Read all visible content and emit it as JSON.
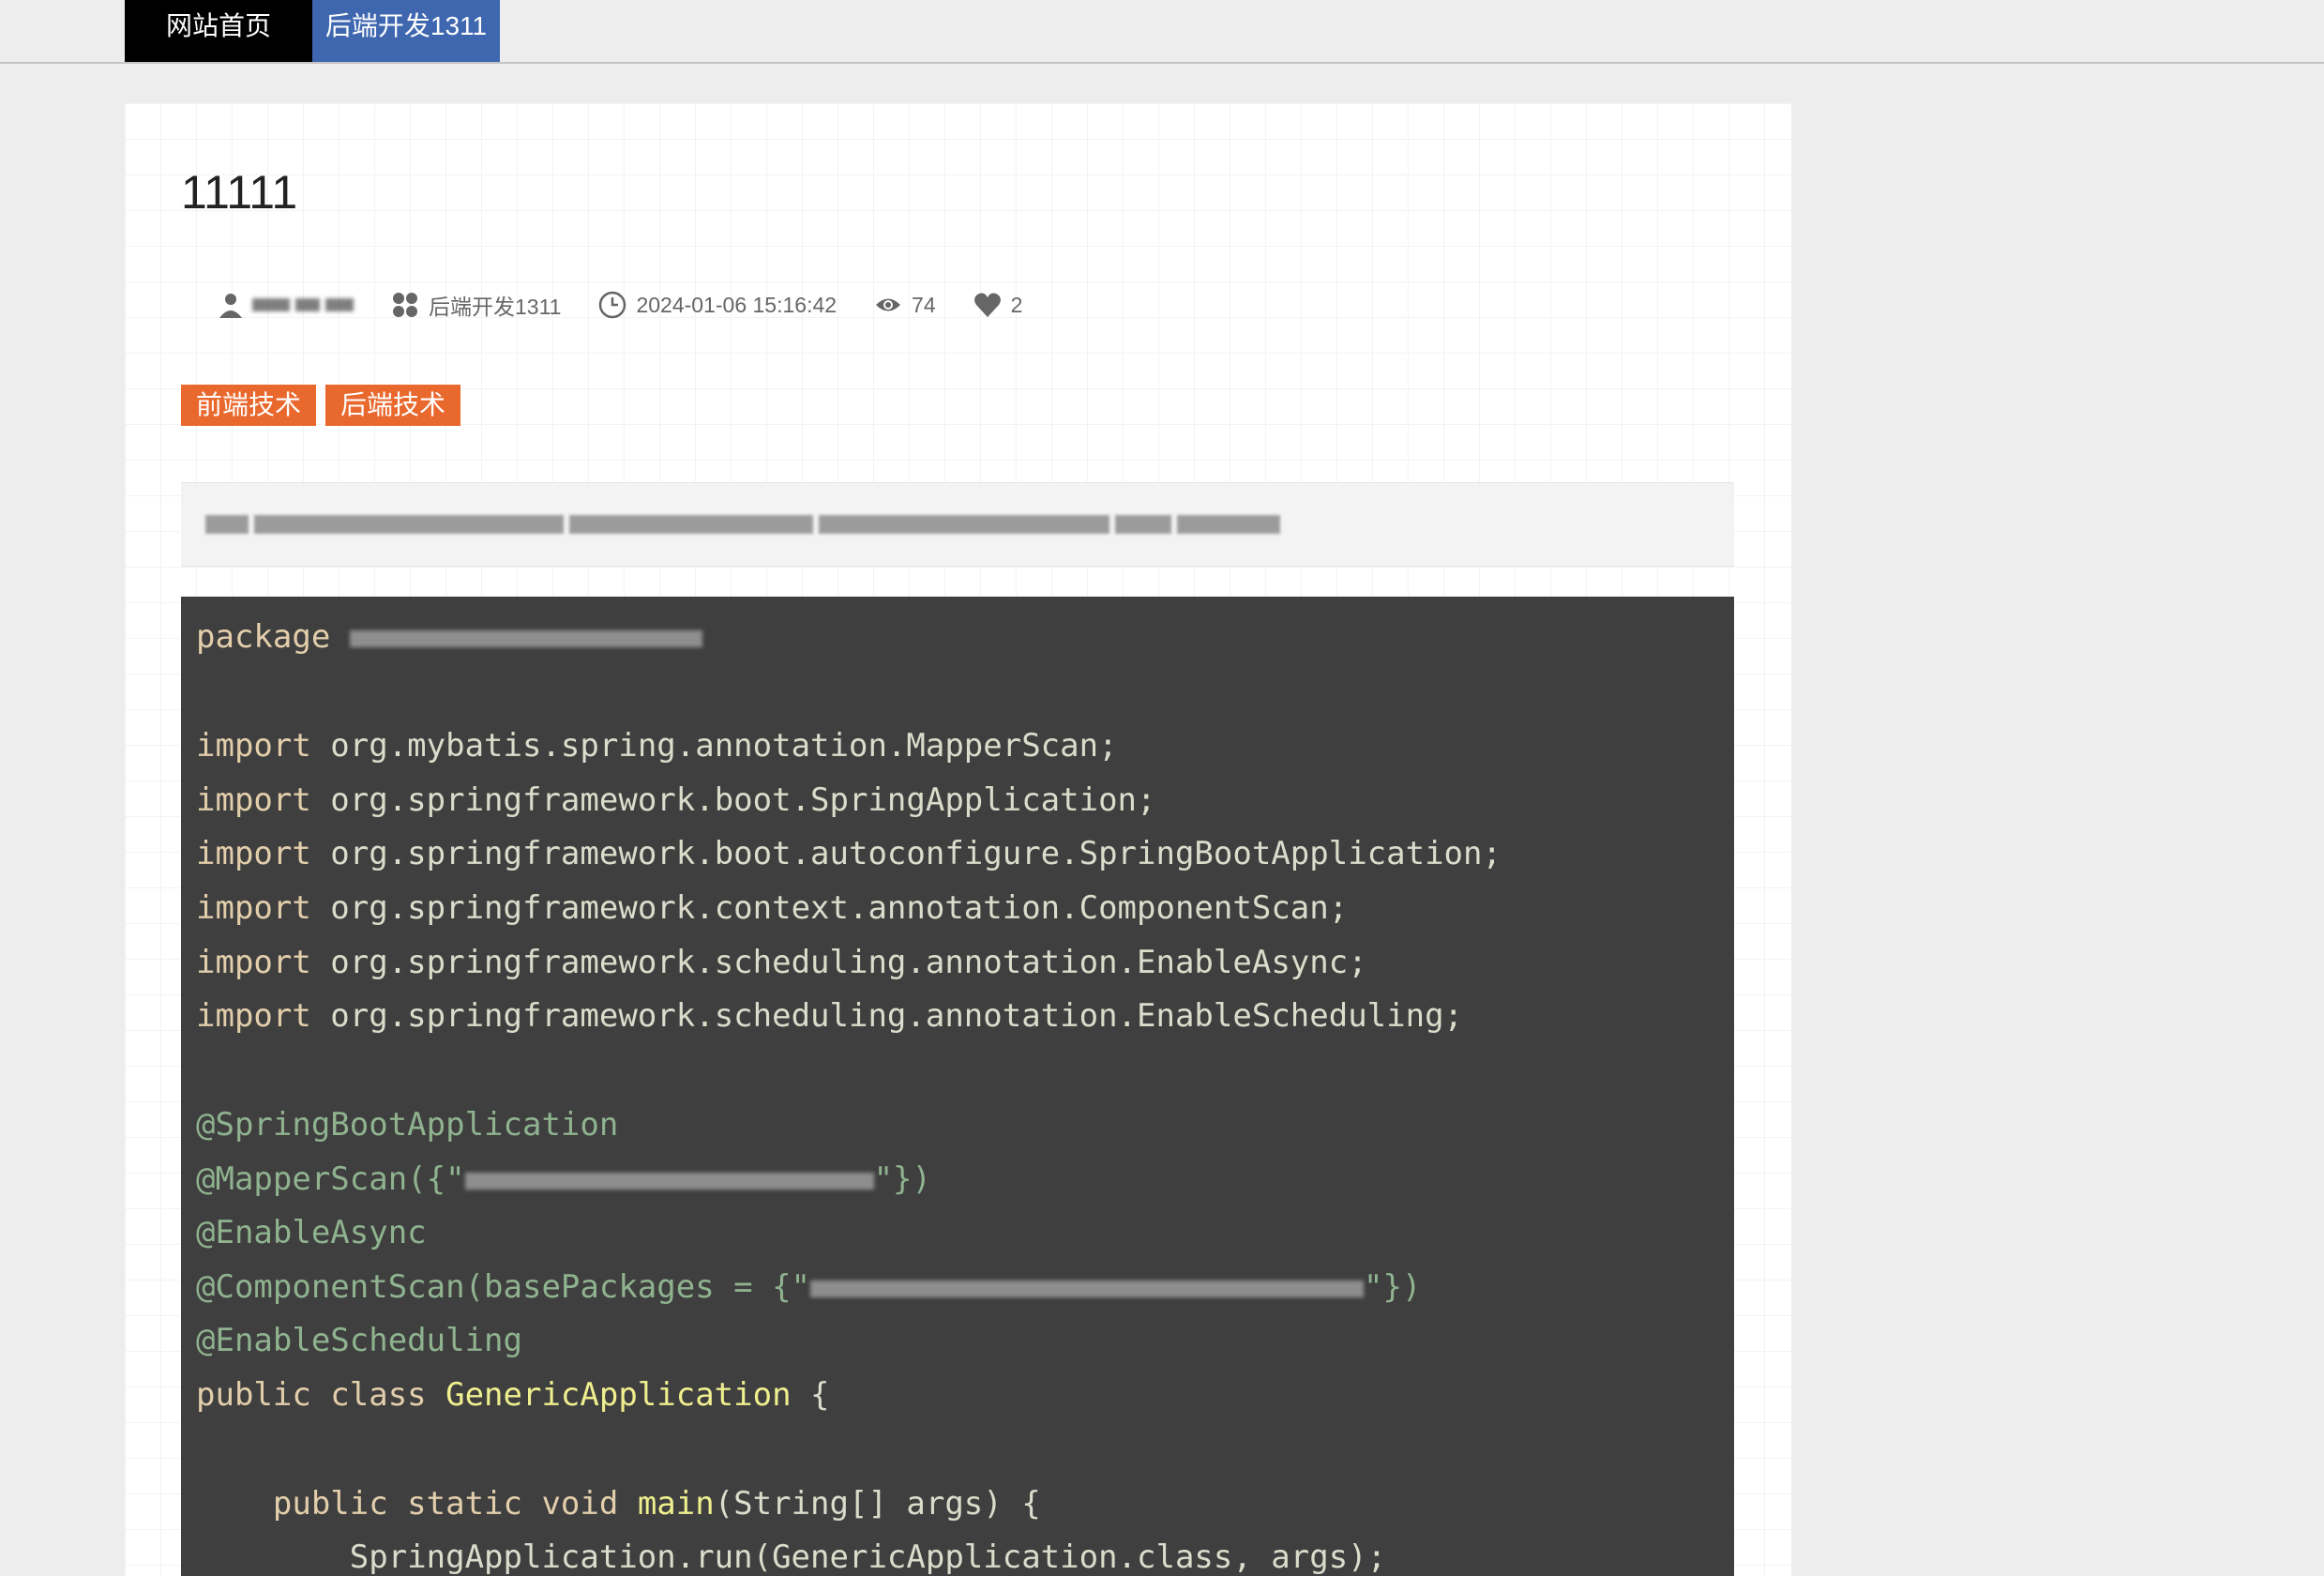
{
  "nav": {
    "home_label": "网站首页",
    "category_label": "后端开发1311"
  },
  "article": {
    "title": "11111",
    "meta": {
      "category": "后端开发1311",
      "datetime": "2024-01-06 15:16:42",
      "views": "74",
      "likes": "2"
    },
    "tags": [
      "前端技术",
      "后端技术"
    ]
  },
  "code": {
    "package_kw": "package",
    "lines": [
      {
        "kw": "import",
        "rest": " org.mybatis.spring.annotation.MapperScan;"
      },
      {
        "kw": "import",
        "rest": " org.springframework.boot.SpringApplication;"
      },
      {
        "kw": "import",
        "rest": " org.springframework.boot.autoconfigure.SpringBootApplication;"
      },
      {
        "kw": "import",
        "rest": " org.springframework.context.annotation.ComponentScan;"
      },
      {
        "kw": "import",
        "rest": " org.springframework.scheduling.annotation.EnableAsync;"
      },
      {
        "kw": "import",
        "rest": " org.springframework.scheduling.annotation.EnableScheduling;"
      }
    ],
    "ann_springboot": "@SpringBootApplication",
    "ann_mapperscan_open": "@MapperScan({\"",
    "ann_mapperscan_close": "\"})",
    "ann_async": "@EnableAsync",
    "ann_componentscan_open": "@ComponentScan(basePackages = {\"",
    "ann_componentscan_close": "\"})",
    "ann_scheduling": "@EnableScheduling",
    "class_kw": "public class ",
    "class_name": "GenericApplication",
    "class_open": " {",
    "main_kw": "    public static void ",
    "main_name": "main",
    "main_rest": "(String[] args) {",
    "run_line": "        SpringApplication.run(GenericApplication.class, args);"
  },
  "colors": {
    "nav_home_bg": "#000000",
    "nav_cat_bg": "#3f67b0",
    "tag_bg": "#e9682e",
    "code_bg": "#3f3f3f"
  }
}
